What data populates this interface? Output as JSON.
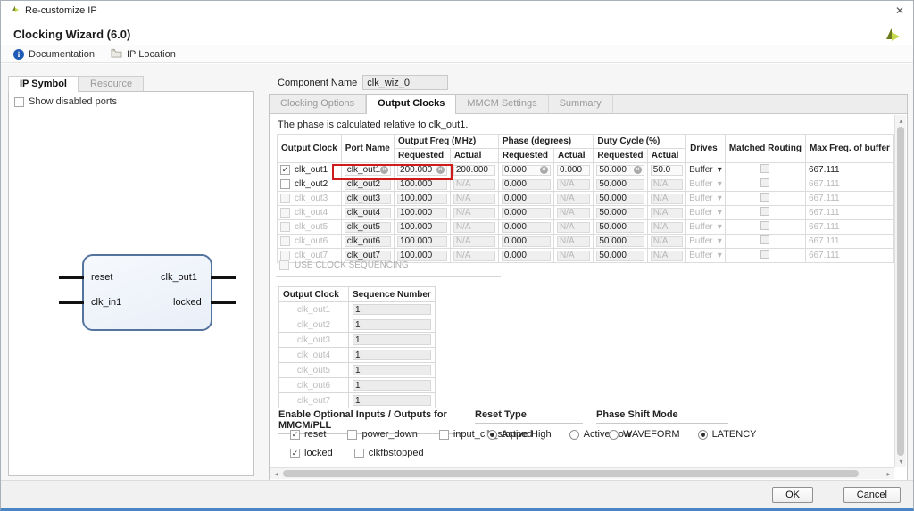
{
  "window": {
    "title": "Re-customize IP",
    "close": "✕"
  },
  "header": {
    "title": "Clocking Wizard (6.0)"
  },
  "toolbar": {
    "documentation": "Documentation",
    "ip_location": "IP Location",
    "info_glyph": "i"
  },
  "icons": {
    "clear": "✕",
    "dropdown": "▾",
    "check": "✓",
    "scroll_up": "▴",
    "scroll_down": "▾",
    "scroll_left": "◂",
    "scroll_right": "▸"
  },
  "left_panel": {
    "tabs": [
      {
        "label": "IP Symbol",
        "active": true
      },
      {
        "label": "Resource",
        "active": false
      }
    ],
    "show_disabled_ports": "Show disabled ports",
    "symbol": {
      "left_ports": [
        "reset",
        "clk_in1"
      ],
      "right_ports": [
        "clk_out1",
        "locked"
      ]
    }
  },
  "component": {
    "label": "Component Name",
    "value": "clk_wiz_0"
  },
  "main_tabs": [
    {
      "label": "Clocking Options",
      "active": false
    },
    {
      "label": "Output Clocks",
      "active": true
    },
    {
      "label": "MMCM Settings",
      "active": false
    },
    {
      "label": "Summary",
      "active": false
    }
  ],
  "phase_note": "The phase is calculated relative to clk_out1.",
  "clock_table": {
    "headers": {
      "output_clock": "Output Clock",
      "port_name": "Port Name",
      "freq_group": "Output Freq (MHz)",
      "phase_group": "Phase (degrees)",
      "duty_group": "Duty Cycle (%)",
      "requested": "Requested",
      "actual": "Actual",
      "drives": "Drives",
      "matched_routing": "Matched Routing",
      "max_freq": "Max Freq. of buffer"
    },
    "rows": [
      {
        "name": "clk_out1",
        "checked": true,
        "label_dim": false,
        "port": "clk_out1",
        "freq_req": "200.000",
        "freq_act": "200.000",
        "phase_req": "0.000",
        "phase_act": "0.000",
        "duty_req": "50.000",
        "duty_act": "50.0",
        "drives": "Buffer",
        "matched": false,
        "max_freq": "667.111",
        "clearable": true,
        "active": true,
        "highlight": true
      },
      {
        "name": "clk_out2",
        "checked": false,
        "label_dim": false,
        "port": "clk_out2",
        "freq_req": "100.000",
        "freq_act": "N/A",
        "phase_req": "0.000",
        "phase_act": "N/A",
        "duty_req": "50.000",
        "duty_act": "N/A",
        "drives": "Buffer",
        "matched": false,
        "max_freq": "667.111",
        "clearable": false,
        "active": false,
        "highlight": false
      },
      {
        "name": "clk_out3",
        "checked": false,
        "label_dim": true,
        "port": "clk_out3",
        "freq_req": "100.000",
        "freq_act": "N/A",
        "phase_req": "0.000",
        "phase_act": "N/A",
        "duty_req": "50.000",
        "duty_act": "N/A",
        "drives": "Buffer",
        "matched": false,
        "max_freq": "667.111",
        "clearable": false,
        "active": false,
        "highlight": false
      },
      {
        "name": "clk_out4",
        "checked": false,
        "label_dim": true,
        "port": "clk_out4",
        "freq_req": "100.000",
        "freq_act": "N/A",
        "phase_req": "0.000",
        "phase_act": "N/A",
        "duty_req": "50.000",
        "duty_act": "N/A",
        "drives": "Buffer",
        "matched": false,
        "max_freq": "667.111",
        "clearable": false,
        "active": false,
        "highlight": false
      },
      {
        "name": "clk_out5",
        "checked": false,
        "label_dim": true,
        "port": "clk_out5",
        "freq_req": "100.000",
        "freq_act": "N/A",
        "phase_req": "0.000",
        "phase_act": "N/A",
        "duty_req": "50.000",
        "duty_act": "N/A",
        "drives": "Buffer",
        "matched": false,
        "max_freq": "667.111",
        "clearable": false,
        "active": false,
        "highlight": false
      },
      {
        "name": "clk_out6",
        "checked": false,
        "label_dim": true,
        "port": "clk_out6",
        "freq_req": "100.000",
        "freq_act": "N/A",
        "phase_req": "0.000",
        "phase_act": "N/A",
        "duty_req": "50.000",
        "duty_act": "N/A",
        "drives": "Buffer",
        "matched": false,
        "max_freq": "667.111",
        "clearable": false,
        "active": false,
        "highlight": false
      },
      {
        "name": "clk_out7",
        "checked": false,
        "label_dim": true,
        "port": "clk_out7",
        "freq_req": "100.000",
        "freq_act": "N/A",
        "phase_req": "0.000",
        "phase_act": "N/A",
        "duty_req": "50.000",
        "duty_act": "N/A",
        "drives": "Buffer",
        "matched": false,
        "max_freq": "667.111",
        "clearable": false,
        "active": false,
        "highlight": false
      }
    ]
  },
  "sequencing": {
    "checkbox_label": "USE CLOCK SEQUENCING",
    "headers": {
      "clock": "Output Clock",
      "seq": "Sequence Number"
    },
    "rows": [
      {
        "clock": "clk_out1",
        "seq": "1"
      },
      {
        "clock": "clk_out2",
        "seq": "1"
      },
      {
        "clock": "clk_out3",
        "seq": "1"
      },
      {
        "clock": "clk_out4",
        "seq": "1"
      },
      {
        "clock": "clk_out5",
        "seq": "1"
      },
      {
        "clock": "clk_out6",
        "seq": "1"
      },
      {
        "clock": "clk_out7",
        "seq": "1"
      }
    ]
  },
  "options": {
    "title": "Enable Optional Inputs / Outputs for MMCM/PLL",
    "row1": [
      {
        "label": "reset",
        "checked": true
      },
      {
        "label": "power_down",
        "checked": false
      },
      {
        "label": "input_clk_stopped",
        "checked": false
      }
    ],
    "row2": [
      {
        "label": "locked",
        "checked": true
      },
      {
        "label": "clkfbstopped",
        "checked": false
      }
    ]
  },
  "reset_type": {
    "title": "Reset Type",
    "options": [
      {
        "label": "Active High",
        "selected": true
      },
      {
        "label": "Active Low",
        "selected": false
      }
    ]
  },
  "phase_shift": {
    "title": "Phase Shift Mode",
    "options": [
      {
        "label": "WAVEFORM",
        "selected": false
      },
      {
        "label": "LATENCY",
        "selected": true
      }
    ]
  },
  "footer": {
    "ok": "OK",
    "cancel": "Cancel"
  }
}
